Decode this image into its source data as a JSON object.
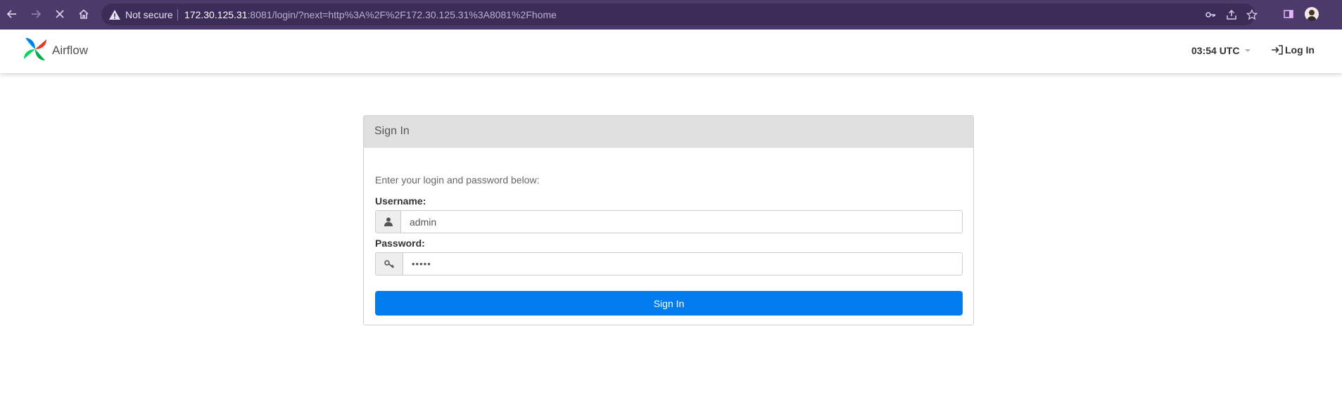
{
  "browser": {
    "security_text": "Not secure",
    "url_host": "172.30.125.31",
    "url_rest": ":8081/login/?next=http%3A%2F%2F172.30.125.31%3A8081%2Fhome"
  },
  "navbar": {
    "brand_name": "Airflow",
    "clock": "03:54 UTC",
    "login_label": "Log In"
  },
  "login_panel": {
    "heading": "Sign In",
    "intro": "Enter your login and password below:",
    "username_label": "Username:",
    "username_value": "admin",
    "password_label": "Password:",
    "password_value": "•••••",
    "submit_label": "Sign In"
  },
  "colors": {
    "browser_bar": "#4c3a6b",
    "primary_button": "#017cee"
  }
}
